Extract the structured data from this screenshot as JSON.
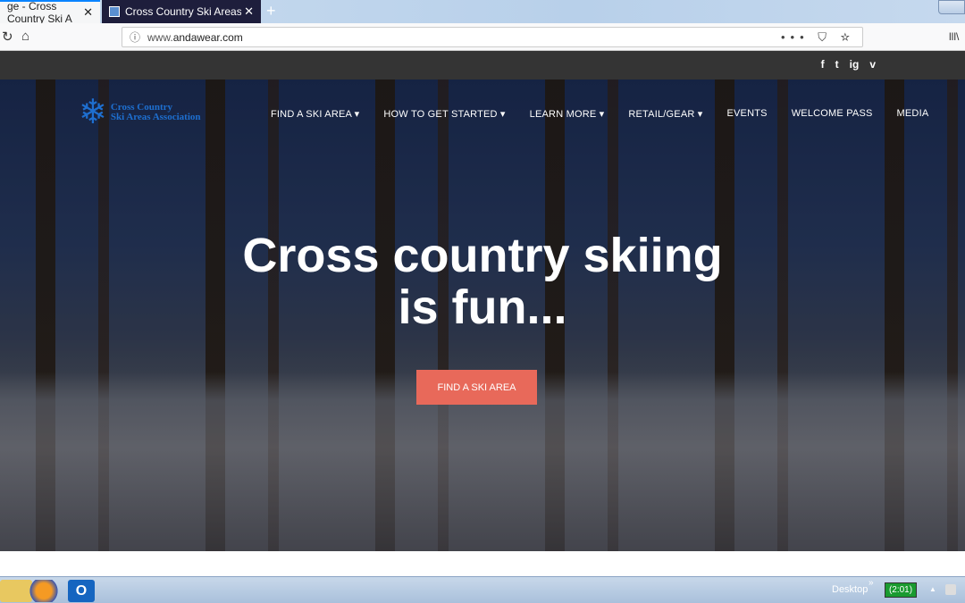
{
  "browser": {
    "tabs": [
      {
        "title": "ge - Cross Country Ski A"
      },
      {
        "title": "Cross Country Ski Areas Associa"
      }
    ],
    "new_tab": "+",
    "url_prefix": "www.",
    "url_domain": "andawear.com",
    "page_actions": "••• ⛉ ☆",
    "library": "lll\\"
  },
  "site": {
    "social": [
      "f",
      "t",
      "ig",
      "v"
    ],
    "logo": {
      "line1": "Cross Country",
      "line2": "Ski Areas Association"
    },
    "menu": [
      "FIND A SKI AREA ▾",
      "HOW TO GET STARTED ▾",
      "LEARN MORE ▾",
      "RETAIL/GEAR ▾",
      "EVENTS",
      "WELCOME PASS",
      "MEDIA"
    ],
    "headline_1": "Cross country skiing",
    "headline_2": "is fun...",
    "cta": "FIND A SKI AREA",
    "cta_color": "#e8695a"
  },
  "taskbar": {
    "desktop": "Desktop",
    "chevron": "»",
    "battery": "(2:01)",
    "tray_arrow": "▲"
  }
}
